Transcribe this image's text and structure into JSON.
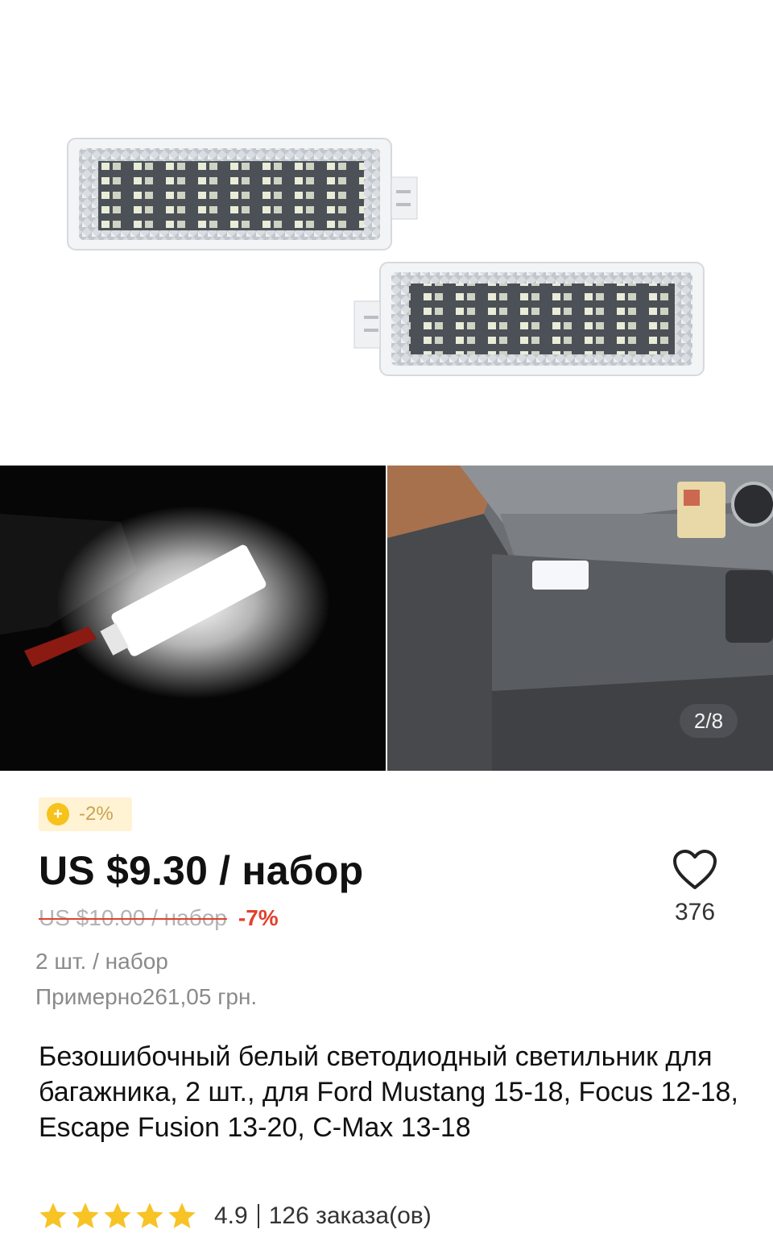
{
  "gallery": {
    "counter": "2/8",
    "images": [
      "led-trunk-lights-product",
      "led-light-glowing",
      "led-light-installed-in-trunk"
    ]
  },
  "promo": {
    "coin_icon": "coin-plus-icon",
    "coin_label": "-2%",
    "colors": {
      "badge_bg": "#fff3d3",
      "coin": "#f6c21b",
      "text": "#c9a352"
    }
  },
  "price": {
    "current": "US $9.30 / набор",
    "old": "US $10.00 / набор",
    "discount": "-7%",
    "colors": {
      "discount": "#e1412e"
    }
  },
  "details": {
    "quantity": "2 шт. / набор",
    "approx": "Примерно261,05 грн."
  },
  "wishlist": {
    "icon": "heart-icon",
    "count": "376"
  },
  "product": {
    "title": "Безошибочный белый светодиодный светильник для багажника, 2 шт., для Ford Mustang 15-18, Focus 12-18, Escape Fusion 13-20, C-Max 13-18"
  },
  "rating": {
    "stars": 5,
    "value": "4.9",
    "orders": "126 заказа(ов)",
    "colors": {
      "star": "#f7c325"
    }
  }
}
